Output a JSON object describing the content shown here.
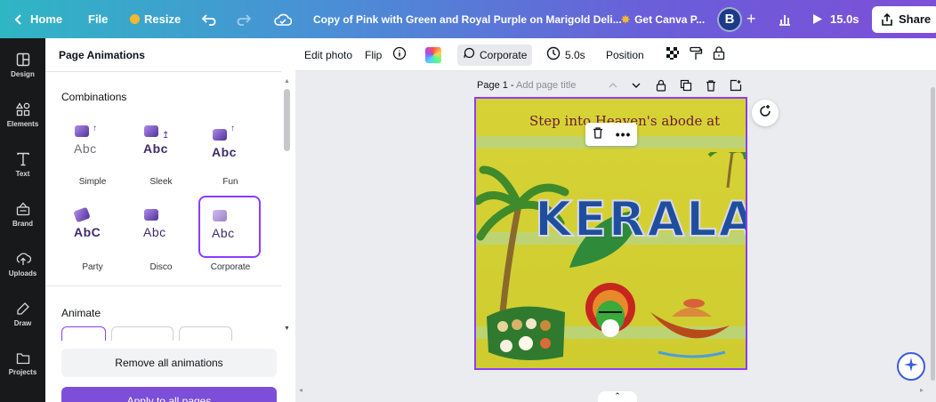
{
  "topbar": {
    "home": "Home",
    "file": "File",
    "resize": "Resize",
    "doc_title": "Copy of Pink with Green and Royal Purple on Marigold Deli...",
    "get_canva": "Get Canva P...",
    "avatar_initial": "B",
    "duration": "15.0s",
    "share": "Share"
  },
  "rail": {
    "items": [
      {
        "label": "Design",
        "icon": "layout-icon"
      },
      {
        "label": "Elements",
        "icon": "shapes-icon"
      },
      {
        "label": "Text",
        "icon": "text-icon"
      },
      {
        "label": "Brand",
        "icon": "brand-icon"
      },
      {
        "label": "Uploads",
        "icon": "cloud-upload-icon"
      },
      {
        "label": "Draw",
        "icon": "pen-icon"
      },
      {
        "label": "Projects",
        "icon": "folder-icon"
      }
    ]
  },
  "panel": {
    "title": "Page Animations",
    "combinations_title": "Combinations",
    "animations": [
      {
        "label": "Simple",
        "abc": "Abc"
      },
      {
        "label": "Sleek",
        "abc": "Abc"
      },
      {
        "label": "Fun",
        "abc": "Abc"
      },
      {
        "label": "Party",
        "abc": "AbC"
      },
      {
        "label": "Disco",
        "abc": "Abc"
      },
      {
        "label": "Corporate",
        "abc": "Abc",
        "selected": true
      }
    ],
    "animate_title": "Animate",
    "remove_all": "Remove all animations",
    "apply_all": "Apply to all pages"
  },
  "context_toolbar": {
    "edit_photo": "Edit photo",
    "flip": "Flip",
    "animation": "Corporate",
    "timing": "5.0s",
    "position": "Position"
  },
  "canvas": {
    "page_label": "Page 1 -",
    "page_title_placeholder": "Add page title",
    "design_heading": "Step into Heaven's abode at",
    "design_title": "KERALA"
  },
  "colors": {
    "accent": "#8b3dff",
    "rail_bg": "#18191b",
    "design_bg": "#d7d336",
    "title_blue": "#1f4f9c"
  }
}
